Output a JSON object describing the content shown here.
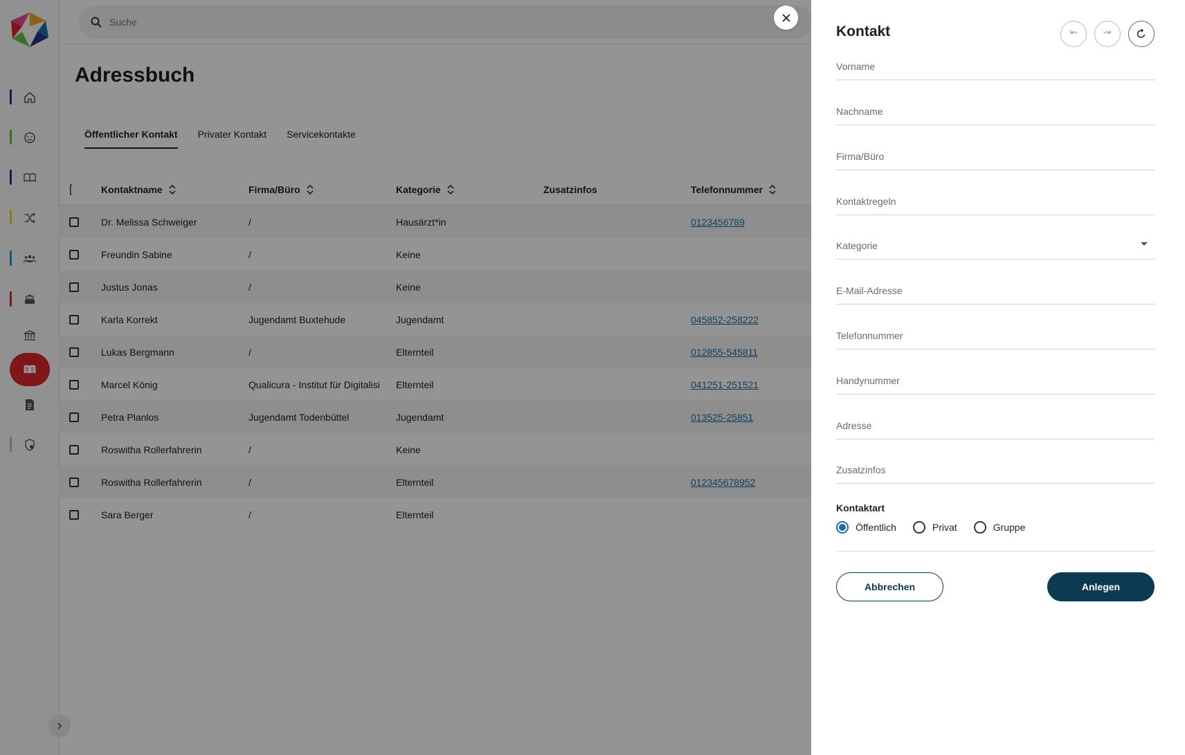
{
  "colors": {
    "primary": "#0b3a52",
    "link": "#1c6fa8",
    "active_nav": "#d9262e"
  },
  "search": {
    "placeholder": "Suche"
  },
  "page": {
    "title": "Adressbuch"
  },
  "tabs": [
    {
      "label": "Öffentlicher Kontakt",
      "active": true
    },
    {
      "label": "Privater Kontakt",
      "active": false
    },
    {
      "label": "Servicekontakte",
      "active": false
    }
  ],
  "table": {
    "select_all_glyph": "[",
    "columns": [
      "Kontaktname",
      "Firma/Büro",
      "Kategorie",
      "Zusatzinfos",
      "Telefonnummer"
    ],
    "rows": [
      {
        "name": "Dr. Melissa Schweiger",
        "firma": "/",
        "kategorie": "Hausärzt*in",
        "zusatz": "",
        "telefon": "0123456789"
      },
      {
        "name": "Freundin Sabine",
        "firma": "/",
        "kategorie": "Keine",
        "zusatz": "",
        "telefon": ""
      },
      {
        "name": "Justus Jonas",
        "firma": "/",
        "kategorie": "Keine",
        "zusatz": "",
        "telefon": ""
      },
      {
        "name": "Karla Korrekt",
        "firma": "Jugendamt Buxtehude",
        "kategorie": "Jugendamt",
        "zusatz": "",
        "telefon": "045852-258222"
      },
      {
        "name": "Lukas Bergmann",
        "firma": "/",
        "kategorie": "Elternteil",
        "zusatz": "",
        "telefon": "012855-545811"
      },
      {
        "name": "Marcel König",
        "firma": "Qualicura - Institut für Digitalisi",
        "kategorie": "Elternteil",
        "zusatz": "",
        "telefon": "041251-251521"
      },
      {
        "name": "Petra Planlos",
        "firma": "Jugendamt Todenbüttel",
        "kategorie": "Jugendamt",
        "zusatz": "",
        "telefon": "013525-25851"
      },
      {
        "name": "Roswitha Rollerfahrerin",
        "firma": "/",
        "kategorie": "Keine",
        "zusatz": "",
        "telefon": ""
      },
      {
        "name": "Roswitha Rollerfahrerin",
        "firma": "/",
        "kategorie": "Elternteil",
        "zusatz": "",
        "telefon": "012345678952"
      },
      {
        "name": "Sara Berger",
        "firma": "/",
        "kategorie": "Elternteil",
        "zusatz": "",
        "telefon": ""
      }
    ]
  },
  "drawer": {
    "title": "Kontakt",
    "fields": {
      "vorname": "Vorname",
      "nachname": "Nachname",
      "firma": "Firma/Büro",
      "kontaktregeln": "Kontaktregeln",
      "kategorie": "Kategorie",
      "email": "E-Mail-Adresse",
      "telefon": "Telefonnummer",
      "handy": "Handynummer",
      "adresse": "Adresse",
      "zusatzinfos": "Zusatzinfos"
    },
    "kontaktart_label": "Kontaktart",
    "kontaktart_options": [
      {
        "label": "Öffentlich",
        "selected": true
      },
      {
        "label": "Privat",
        "selected": false
      },
      {
        "label": "Gruppe",
        "selected": false
      }
    ],
    "cancel_label": "Abbrechen",
    "submit_label": "Anlegen"
  }
}
